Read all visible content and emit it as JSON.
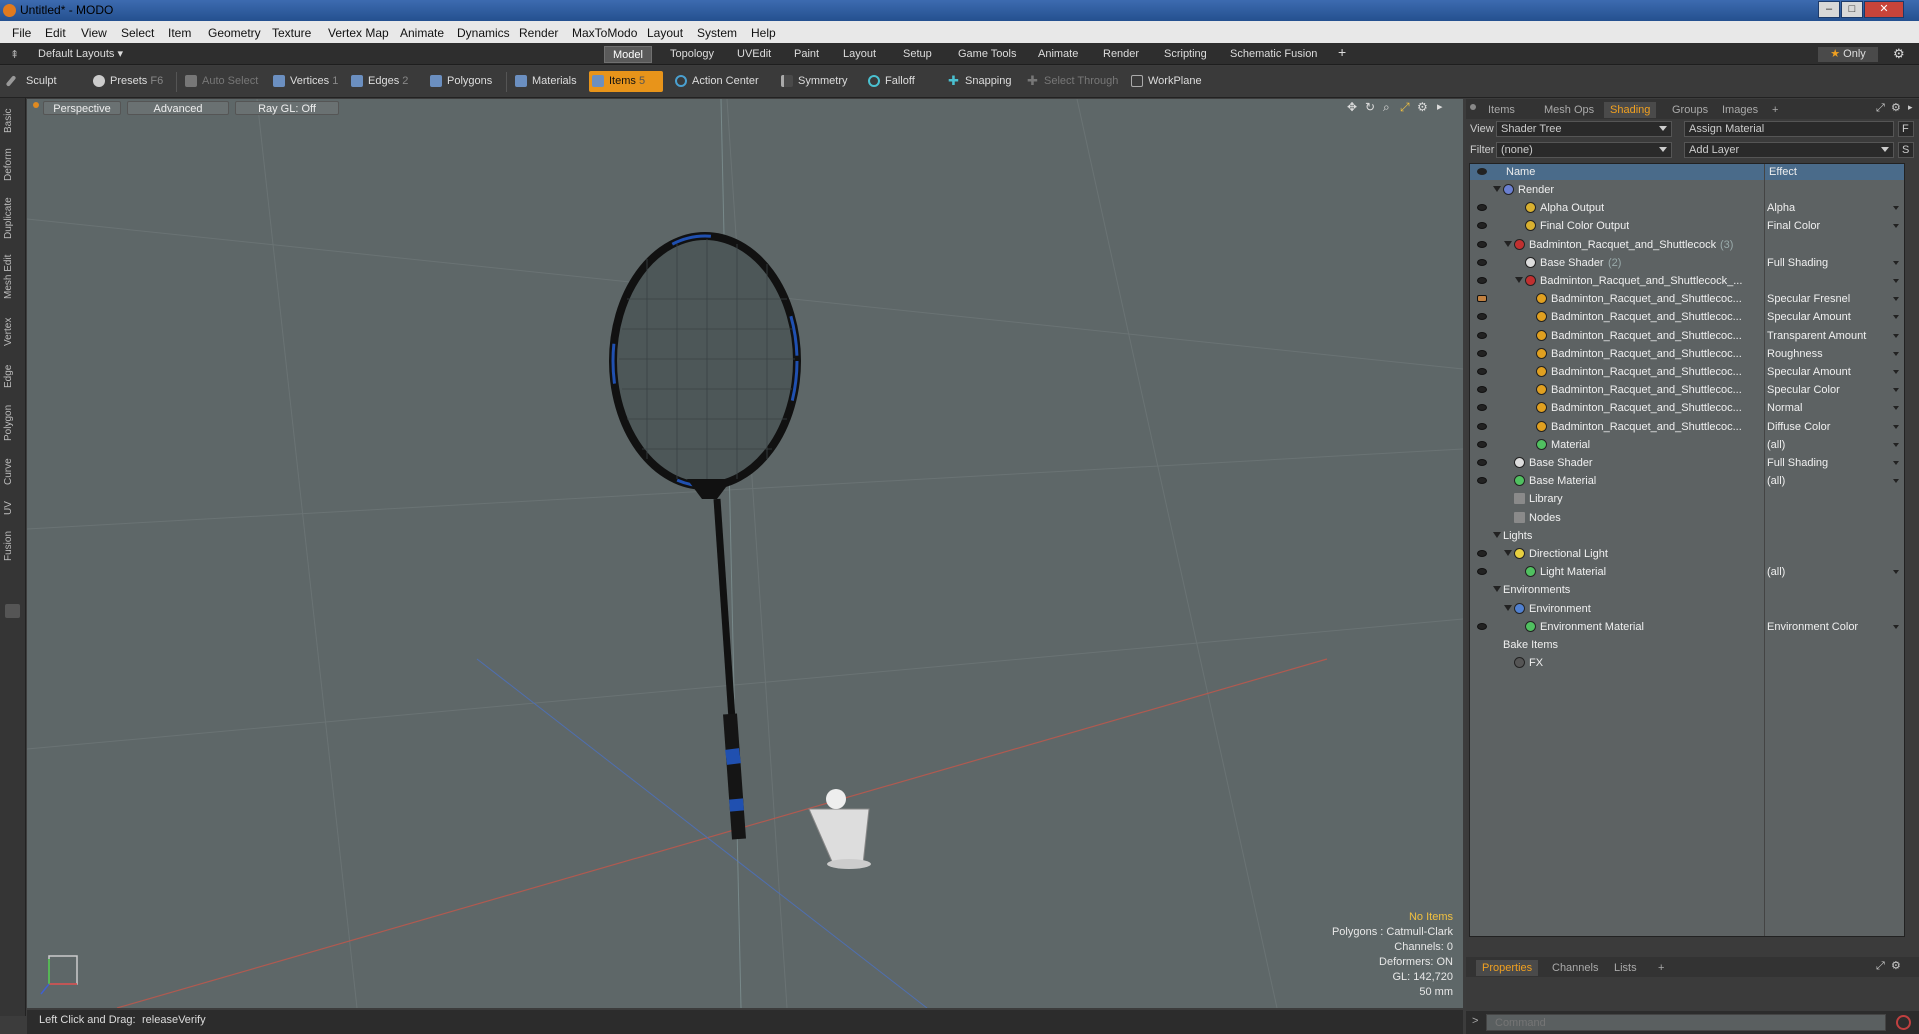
{
  "window": {
    "title": "Untitled* - MODO",
    "minimize": "‒",
    "maximize": "□",
    "close": "✕"
  },
  "menu": [
    "File",
    "Edit",
    "View",
    "Select",
    "Item",
    "Geometry",
    "Texture",
    "Vertex Map",
    "Animate",
    "Dynamics",
    "Render",
    "MaxToModo",
    "Layout",
    "System",
    "Help"
  ],
  "layouts": {
    "current": "Default Layouts",
    "tabs": [
      "Model",
      "Topology",
      "UVEdit",
      "Paint",
      "Layout",
      "Setup",
      "Game Tools",
      "Animate",
      "Render",
      "Scripting",
      "Schematic Fusion"
    ],
    "active_tab": "Model",
    "add": "+",
    "only_label": "Only"
  },
  "toolbar": {
    "sculpt": "Sculpt",
    "presets": "Presets",
    "presets_key": "F6",
    "auto_select": "Auto Select",
    "vertices": "Vertices",
    "vertices_key": "1",
    "edges": "Edges",
    "edges_key": "2",
    "polygons": "Polygons",
    "materials": "Materials",
    "items": "Items",
    "items_key": "5",
    "action_center": "Action Center",
    "symmetry": "Symmetry",
    "falloff": "Falloff",
    "snapping": "Snapping",
    "select_through": "Select Through",
    "workplane": "WorkPlane"
  },
  "sidebar_tabs": [
    "Basic",
    "Deform",
    "Duplicate",
    "Mesh Edit",
    "Vertex",
    "Edge",
    "Polygon",
    "Curve",
    "UV",
    "Fusion"
  ],
  "viewport": {
    "view": "Perspective",
    "mode": "Advanced",
    "raygl": "Ray GL: Off",
    "info": {
      "selection": "No Items",
      "polygons": "Polygons : Catmull-Clark",
      "channels": "Channels: 0",
      "deformers": "Deformers: ON",
      "gl": "GL: 142,720",
      "scale": "50 mm"
    }
  },
  "status": {
    "action": "Left Click and Drag:",
    "value": "releaseVerify"
  },
  "right_panel": {
    "tabs": [
      "Items",
      "Mesh Ops",
      "Shading",
      "Groups",
      "Images",
      "+"
    ],
    "active_tab": "Shading",
    "view_label": "View",
    "view_value": "Shader Tree",
    "assign_material": "Assign Material",
    "f_key": "F",
    "filter_label": "Filter",
    "filter_value": "(none)",
    "add_layer": "Add Layer",
    "s_key": "S",
    "columns": {
      "name": "Name",
      "effect": "Effect"
    },
    "tree": [
      {
        "name": "Render",
        "effect": "",
        "indent": 0,
        "eye": false,
        "icon": "#6a7fd0",
        "twirl": true
      },
      {
        "name": "Alpha Output",
        "effect": "Alpha",
        "indent": 2,
        "eye": true,
        "icon": "#d8b030"
      },
      {
        "name": "Final Color Output",
        "effect": "Final Color",
        "indent": 2,
        "eye": true,
        "icon": "#d8b030"
      },
      {
        "name": "Badminton_Racquet_and_Shuttlecock",
        "count": "(3)",
        "effect": "",
        "indent": 1,
        "eye": true,
        "icon": "#c03030",
        "twirl": true
      },
      {
        "name": "Base Shader",
        "count": "(2)",
        "effect": "Full Shading",
        "indent": 2,
        "eye": true,
        "icon": "#dddddd"
      },
      {
        "name": "Badminton_Racquet_and_Shuttlecock_...",
        "effect": "",
        "indent": 2,
        "eye": true,
        "icon": "#c03030",
        "twirl": true
      },
      {
        "name": "Badminton_Racquet_and_Shuttlecoc...",
        "effect": "Specular Fresnel",
        "indent": 3,
        "eye": true,
        "icon": "#e0a020",
        "brush": true
      },
      {
        "name": "Badminton_Racquet_and_Shuttlecoc...",
        "effect": "Specular Amount",
        "indent": 3,
        "eye": true,
        "icon": "#e0a020"
      },
      {
        "name": "Badminton_Racquet_and_Shuttlecoc...",
        "effect": "Transparent Amount",
        "indent": 3,
        "eye": true,
        "icon": "#e0a020"
      },
      {
        "name": "Badminton_Racquet_and_Shuttlecoc...",
        "effect": "Roughness",
        "indent": 3,
        "eye": true,
        "icon": "#e0a020"
      },
      {
        "name": "Badminton_Racquet_and_Shuttlecoc...",
        "effect": "Specular Amount",
        "indent": 3,
        "eye": true,
        "icon": "#e0a020"
      },
      {
        "name": "Badminton_Racquet_and_Shuttlecoc...",
        "effect": "Specular Color",
        "indent": 3,
        "eye": true,
        "icon": "#e0a020"
      },
      {
        "name": "Badminton_Racquet_and_Shuttlecoc...",
        "effect": "Normal",
        "indent": 3,
        "eye": true,
        "icon": "#e0a020"
      },
      {
        "name": "Badminton_Racquet_and_Shuttlecoc...",
        "effect": "Diffuse Color",
        "indent": 3,
        "eye": true,
        "icon": "#e0a020"
      },
      {
        "name": "Material",
        "effect": "(all)",
        "indent": 3,
        "eye": true,
        "icon": "#50c060"
      },
      {
        "name": "Base Shader",
        "effect": "Full Shading",
        "indent": 1,
        "eye": true,
        "icon": "#dddddd"
      },
      {
        "name": "Base Material",
        "effect": "(all)",
        "indent": 1,
        "eye": true,
        "icon": "#50c060"
      },
      {
        "name": "Library",
        "effect": "",
        "indent": 1,
        "eye": false,
        "icon": "",
        "folder": true
      },
      {
        "name": "Nodes",
        "effect": "",
        "indent": 1,
        "eye": false,
        "icon": "",
        "folder": true
      },
      {
        "name": "Lights",
        "effect": "",
        "indent": 0,
        "eye": false,
        "icon": "",
        "twirl": true
      },
      {
        "name": "Directional Light",
        "effect": "",
        "indent": 1,
        "eye": true,
        "icon": "#e8d040",
        "twirl": true
      },
      {
        "name": "Light Material",
        "effect": "(all)",
        "indent": 2,
        "eye": true,
        "icon": "#50c060"
      },
      {
        "name": "Environments",
        "effect": "",
        "indent": 0,
        "eye": false,
        "icon": "",
        "twirl": true
      },
      {
        "name": "Environment",
        "effect": "",
        "indent": 1,
        "eye": false,
        "icon": "#5080d0",
        "twirl": true
      },
      {
        "name": "Environment Material",
        "effect": "Environment Color",
        "indent": 2,
        "eye": true,
        "icon": "#50c060"
      },
      {
        "name": "Bake Items",
        "effect": "",
        "indent": 0,
        "eye": false,
        "icon": ""
      },
      {
        "name": "FX",
        "effect": "",
        "indent": 1,
        "eye": false,
        "icon": "#555555"
      }
    ],
    "bottom_tabs": [
      "Properties",
      "Channels",
      "Lists",
      "+"
    ],
    "bottom_active": "Properties",
    "command_placeholder": "Command"
  }
}
